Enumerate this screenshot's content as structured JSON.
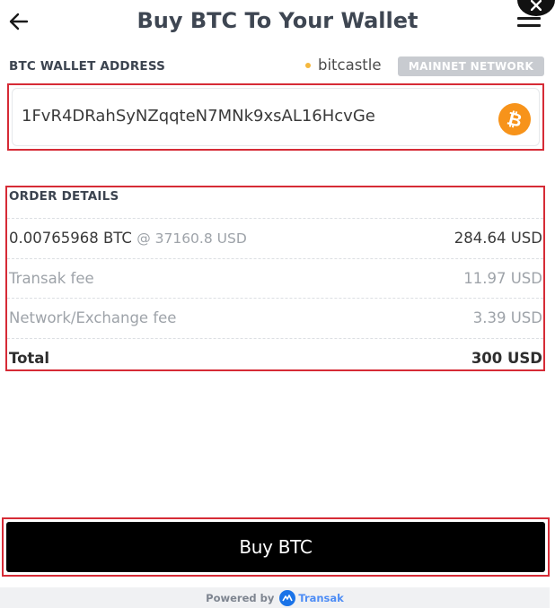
{
  "header": {
    "title": "Buy BTC To Your Wallet",
    "back_icon": "arrow-left-icon",
    "menu_icon": "hamburger-menu-icon",
    "close_icon": "close-icon"
  },
  "wallet": {
    "label": "BTC WALLET ADDRESS",
    "provider": "bitcastle",
    "network": "MAINNET NETWORK",
    "address": "1FvR4DRahSyNZqqteN7MNk9xsAL16HcvGe",
    "coin_icon": "bitcoin-icon"
  },
  "order": {
    "title": "ORDER DETAILS",
    "rows": [
      {
        "label": "0.00765968 BTC",
        "rate": "@ 37160.8 USD",
        "value": "284.64 USD"
      },
      {
        "label": "Transak fee",
        "value": "11.97 USD"
      },
      {
        "label": "Network/Exchange fee",
        "value": "3.39 USD"
      },
      {
        "label": "Total",
        "value": "300 USD"
      }
    ]
  },
  "action": {
    "buy_label": "Buy BTC"
  },
  "footer": {
    "powered_by": "Powered by",
    "brand": "Transak",
    "brand_icon": "transak-logo-icon"
  },
  "colors": {
    "highlight_border": "#d62b36",
    "bitcoin_orange": "#f7931a",
    "button_bg": "#000000",
    "badge_gray": "#c8cbd0"
  }
}
